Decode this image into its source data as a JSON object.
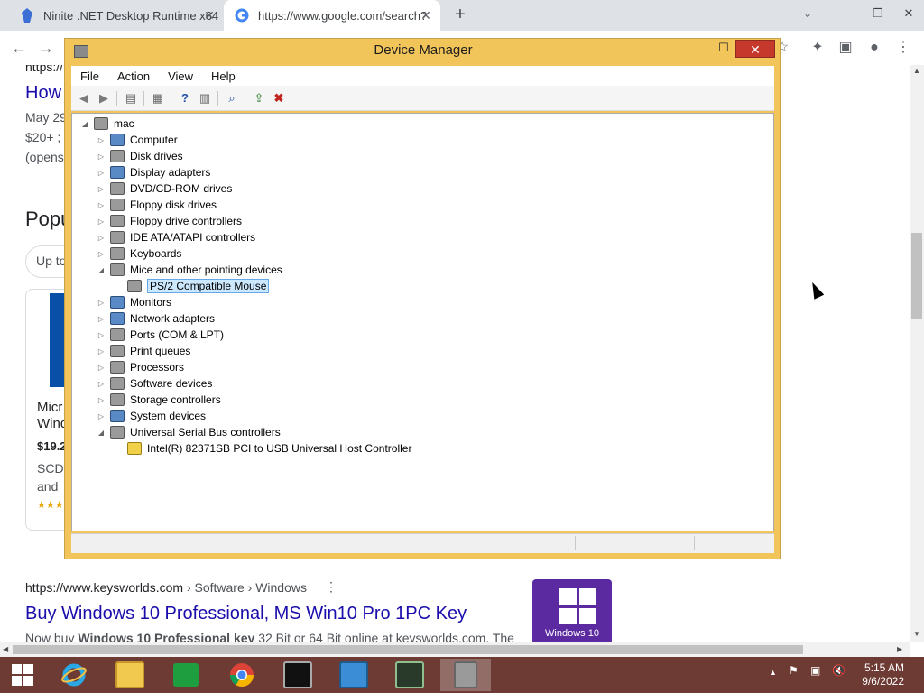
{
  "browser": {
    "tabs": [
      {
        "title": "Ninite .NET Desktop Runtime x64",
        "icon": "ninite-icon"
      },
      {
        "title": "https://www.google.com/search?",
        "icon": "google-icon"
      }
    ],
    "new_tab_label": "+"
  },
  "page": {
    "url_fragment": "https://",
    "result_title_partial": "How",
    "date_partial": "May 29",
    "price_partial": "$20+ ;",
    "opens_partial": "(opens",
    "section_partial": "Popu",
    "chip_partial": "Up to",
    "card_title_line1": "Micr",
    "card_title_line2": "Wind",
    "card_price": "$19.2",
    "card_desc1": "SCD",
    "card_desc2": "and",
    "card_stars": "★★★",
    "result2_url": "https://www.keysworlds.com",
    "result2_breadcrumb": " › Software › Windows",
    "result2_title": "Buy Windows 10 Professional, MS Win10 Pro 1PC Key",
    "result2_snippet_pre": "Now buy ",
    "result2_snippet_bold": "Windows 10 Professional key",
    "result2_snippet_post": " 32 Bit or 64 Bit online at keysworlds.com. The",
    "product_caption": "Windows 10"
  },
  "device_manager": {
    "title": "Device Manager",
    "menu": [
      "File",
      "Action",
      "View",
      "Help"
    ],
    "root": "mac",
    "nodes": [
      {
        "label": "Computer",
        "expanded": false
      },
      {
        "label": "Disk drives",
        "expanded": false
      },
      {
        "label": "Display adapters",
        "expanded": false
      },
      {
        "label": "DVD/CD-ROM drives",
        "expanded": false
      },
      {
        "label": "Floppy disk drives",
        "expanded": false
      },
      {
        "label": "Floppy drive controllers",
        "expanded": false
      },
      {
        "label": "IDE ATA/ATAPI controllers",
        "expanded": false
      },
      {
        "label": "Keyboards",
        "expanded": false
      },
      {
        "label": "Mice and other pointing devices",
        "expanded": true
      },
      {
        "label": "PS/2 Compatible Mouse",
        "child": true,
        "selected": true
      },
      {
        "label": "Monitors",
        "expanded": false
      },
      {
        "label": "Network adapters",
        "expanded": false
      },
      {
        "label": "Ports (COM & LPT)",
        "expanded": false
      },
      {
        "label": "Print queues",
        "expanded": false
      },
      {
        "label": "Processors",
        "expanded": false
      },
      {
        "label": "Software devices",
        "expanded": false
      },
      {
        "label": "Storage controllers",
        "expanded": false
      },
      {
        "label": "System devices",
        "expanded": false
      },
      {
        "label": "Universal Serial Bus controllers",
        "expanded": true
      },
      {
        "label": "Intel(R) 82371SB PCI to USB Universal Host Controller",
        "child": true,
        "warning": true
      }
    ]
  },
  "taskbar": {
    "apps": [
      "start-button",
      "internet-explorer-icon",
      "file-explorer-icon",
      "store-icon",
      "chrome-icon",
      "command-prompt-icon",
      "installer-icon",
      "task-manager-icon",
      "device-manager-icon"
    ],
    "time": "5:15 AM",
    "date": "9/6/2022"
  },
  "colors": {
    "dm_frame": "#f2c55a",
    "close_red": "#c7382c",
    "taskbar": "#6e3b34",
    "link_blue": "#1a0dab"
  }
}
